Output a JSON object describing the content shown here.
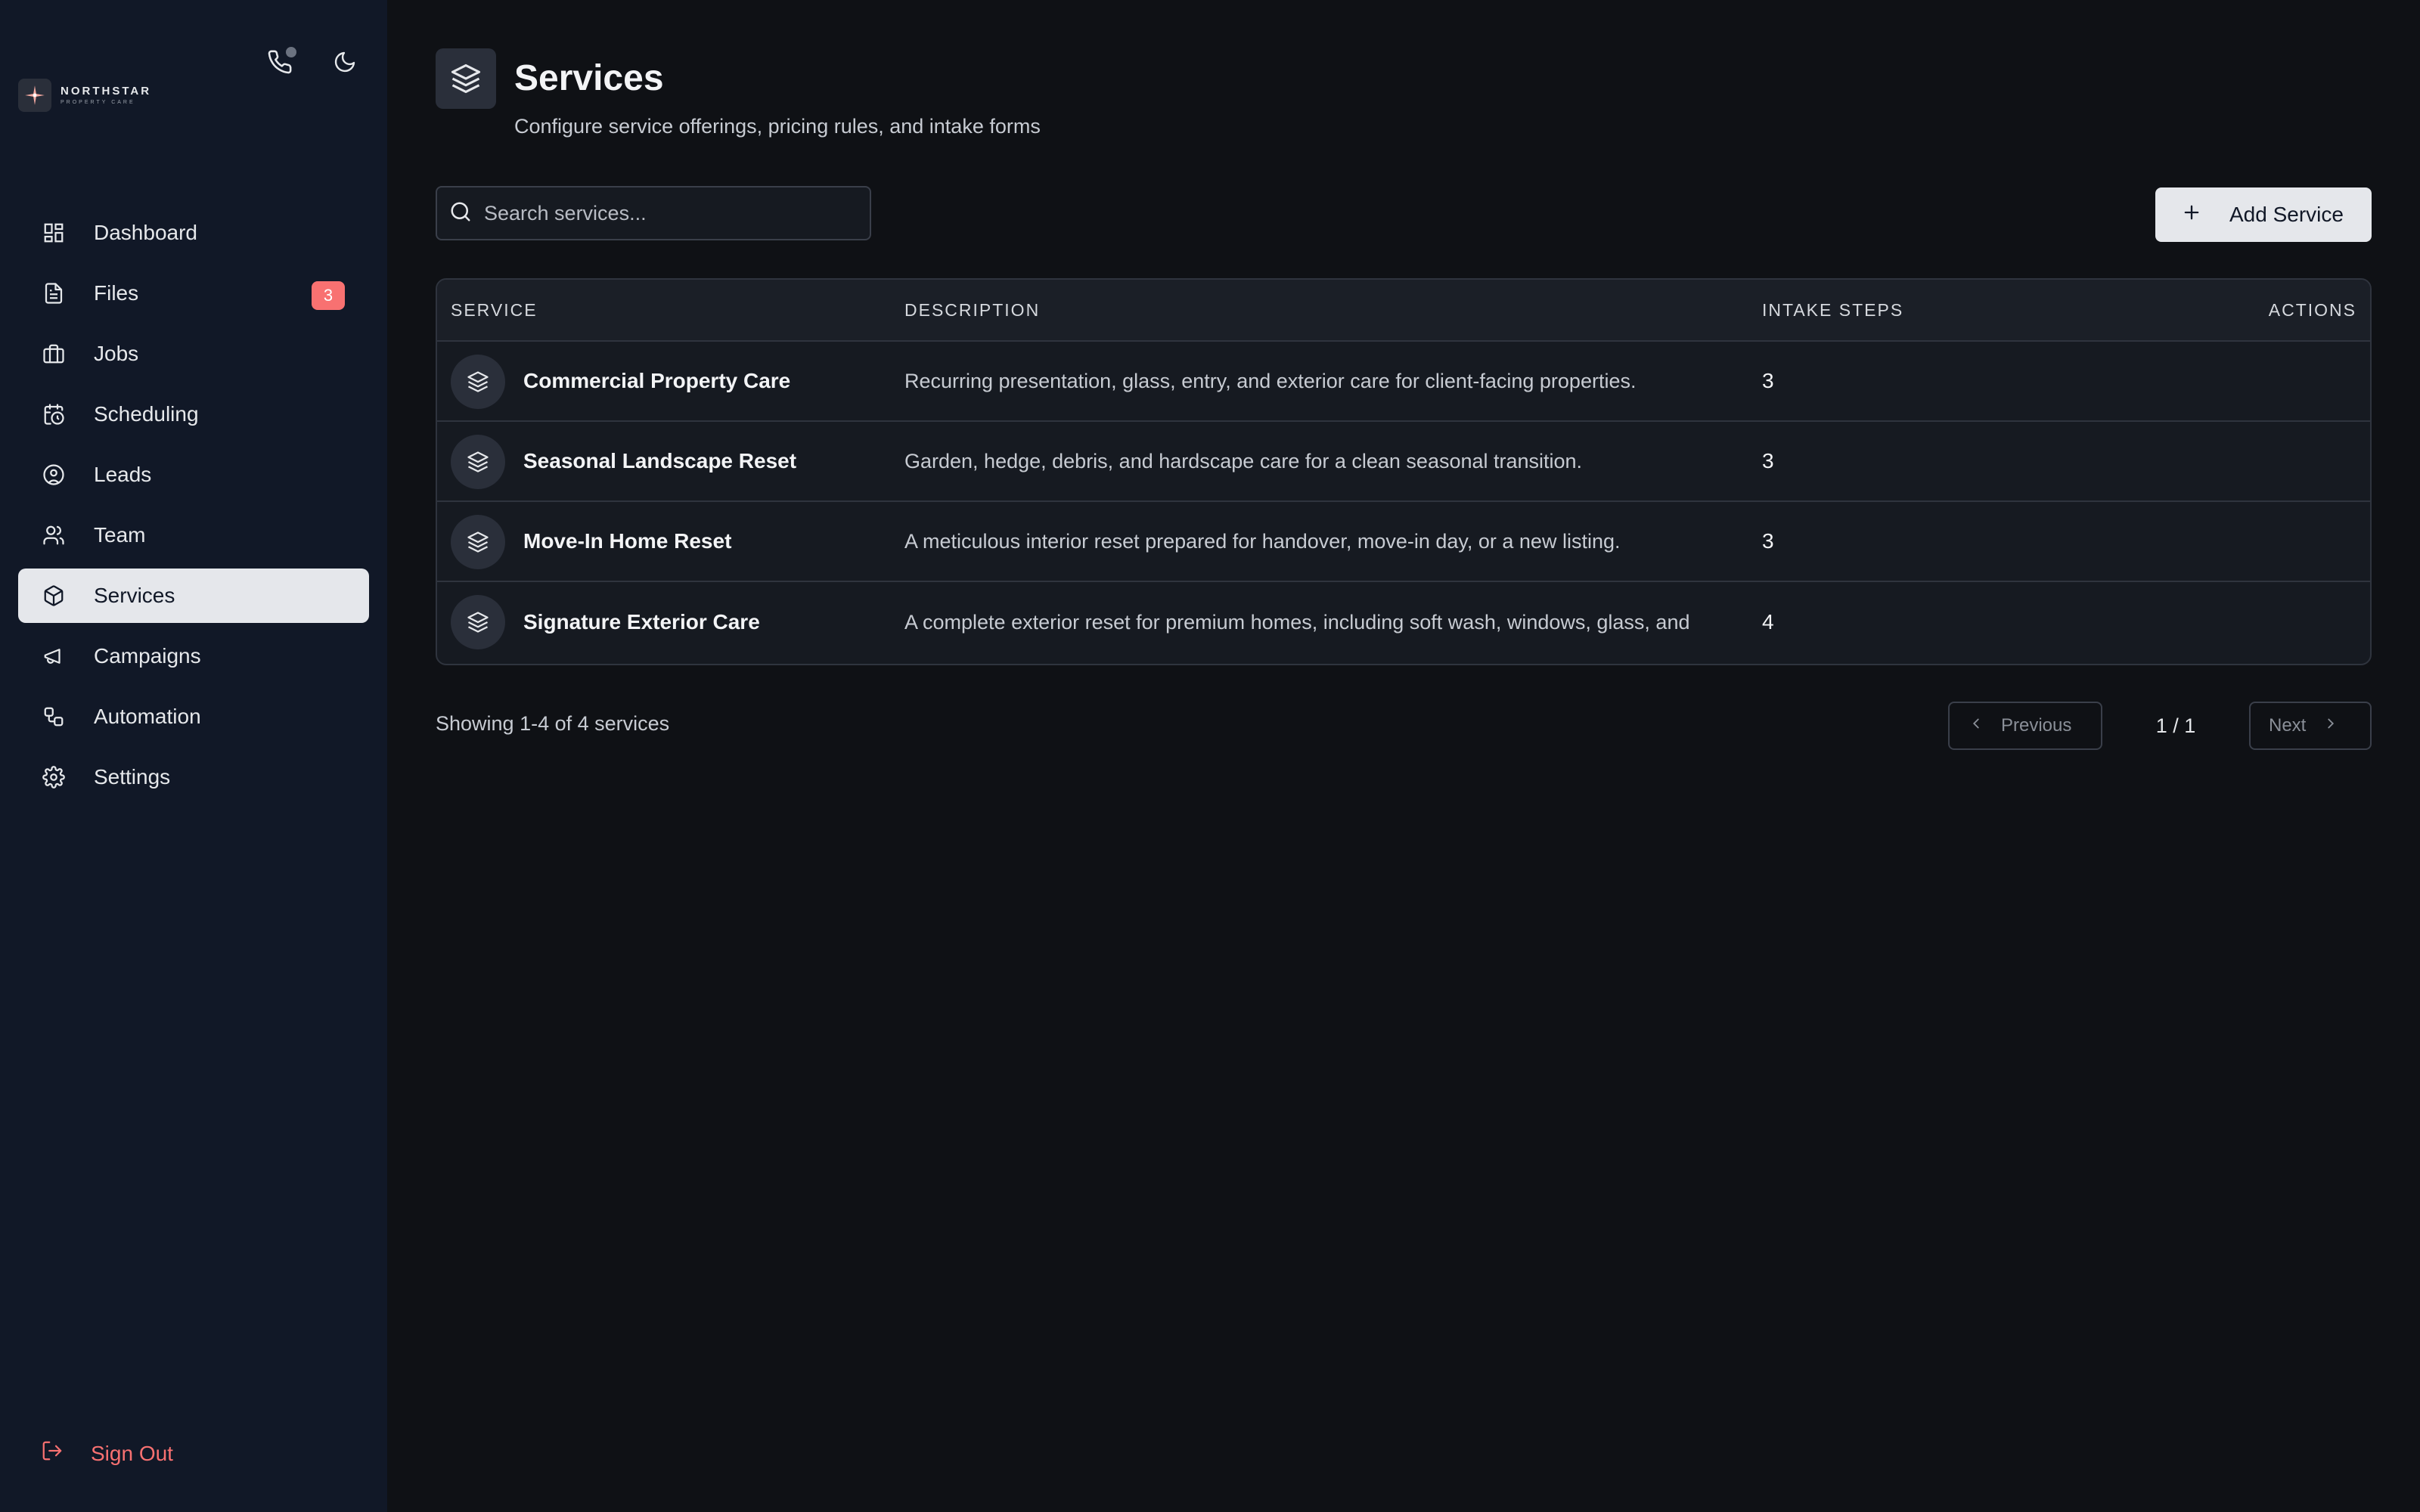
{
  "brand": {
    "name": "NORTHSTAR",
    "sub": "PROPERTY CARE"
  },
  "sidebar": {
    "items": [
      {
        "label": "Dashboard",
        "icon": "dashboard-icon"
      },
      {
        "label": "Files",
        "icon": "file-icon",
        "badge": "3"
      },
      {
        "label": "Jobs",
        "icon": "briefcase-icon"
      },
      {
        "label": "Scheduling",
        "icon": "calendar-clock-icon"
      },
      {
        "label": "Leads",
        "icon": "user-circle-icon"
      },
      {
        "label": "Team",
        "icon": "users-icon"
      },
      {
        "label": "Services",
        "icon": "package-icon",
        "active": true
      },
      {
        "label": "Campaigns",
        "icon": "megaphone-icon"
      },
      {
        "label": "Automation",
        "icon": "workflow-icon"
      },
      {
        "label": "Settings",
        "icon": "gear-icon"
      }
    ],
    "signout_label": "Sign Out"
  },
  "header": {
    "title": "Services",
    "subtitle": "Configure service offerings, pricing rules, and intake forms"
  },
  "search": {
    "placeholder": "Search services...",
    "value": ""
  },
  "toolbar": {
    "add_label": "Add Service"
  },
  "table": {
    "columns": {
      "service": "SERVICE",
      "description": "DESCRIPTION",
      "steps": "INTAKE STEPS",
      "actions": "ACTIONS"
    },
    "rows": [
      {
        "name": "Commercial Property Care",
        "description": "Recurring presentation, glass, entry, and exterior care for client-facing properties.",
        "steps": "3"
      },
      {
        "name": "Seasonal Landscape Reset",
        "description": "Garden, hedge, debris, and hardscape care for a clean seasonal transition.",
        "steps": "3"
      },
      {
        "name": "Move-In Home Reset",
        "description": "A meticulous interior reset prepared for handover, move-in day, or a new listing.",
        "steps": "3"
      },
      {
        "name": "Signature Exterior Care",
        "description": "A complete exterior reset for premium homes, including soft wash, windows, glass, and",
        "steps": "4"
      }
    ]
  },
  "footer": {
    "showing": "Showing 1-4 of 4 services"
  },
  "pagination": {
    "previous": "Previous",
    "page": "1 / 1",
    "next": "Next"
  },
  "colors": {
    "accent_danger": "#f87171",
    "active_bg": "#e5e7eb",
    "sidebar_bg": "#111827",
    "main_bg": "#0f1115"
  }
}
